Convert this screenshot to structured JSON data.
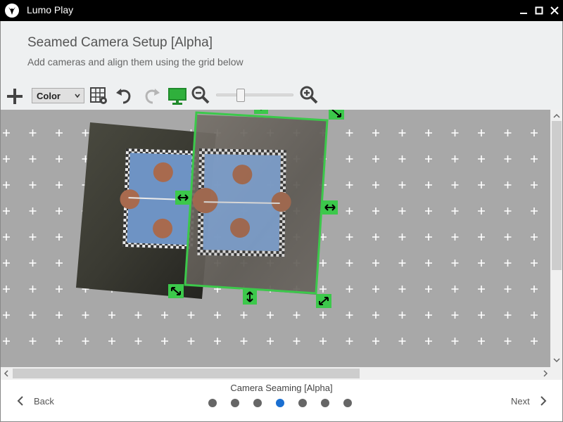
{
  "app": {
    "title": "Lumo Play",
    "logo_icon": "fox-logo-icon"
  },
  "window_controls": {
    "minimize_icon": "minimize-icon",
    "maximize_icon": "maximize-icon",
    "close_icon": "close-icon"
  },
  "header": {
    "title": "Seamed Camera Setup [Alpha]",
    "subtitle": "Add cameras and align them using the grid below"
  },
  "toolbar": {
    "add_icon": "plus-icon",
    "color_select": {
      "value": "Color"
    },
    "grid_icon": "grid-settings-icon",
    "undo_icon": "undo-icon",
    "redo_icon": "redo-icon",
    "monitor_icon": "monitor-icon",
    "zoom_out_icon": "zoom-out-icon",
    "zoom_in_icon": "zoom-in-icon",
    "zoom_level": 0.32
  },
  "canvas": {
    "background": "#a8a8a8",
    "grid_marker": "+",
    "cameras": [
      {
        "name": "camera-1",
        "selected": false
      },
      {
        "name": "camera-2",
        "selected": true
      }
    ],
    "selection_color": "#3cc84b",
    "handle_icons": [
      "horizontal-resize-icon",
      "vertical-resize-icon",
      "rotate-icon"
    ]
  },
  "footer": {
    "step_title": "Camera Seaming [Alpha]",
    "back_label": "Back",
    "next_label": "Next",
    "step_count": 7,
    "active_step": 4,
    "active_color": "#1a6fd1"
  }
}
